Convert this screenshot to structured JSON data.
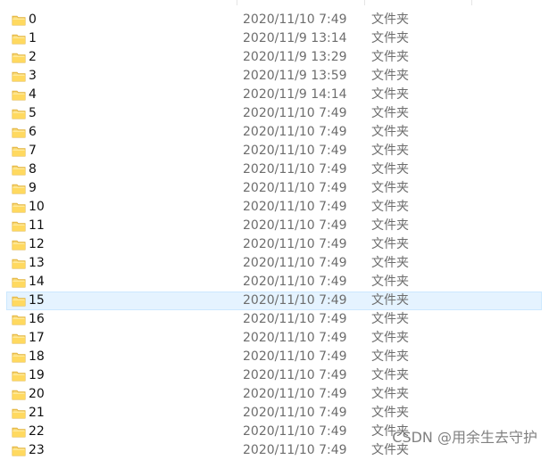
{
  "rows": [
    {
      "name": "0",
      "date": "2020/11/10 7:49",
      "type": "文件夹"
    },
    {
      "name": "1",
      "date": "2020/11/9 13:14",
      "type": "文件夹"
    },
    {
      "name": "2",
      "date": "2020/11/9 13:29",
      "type": "文件夹"
    },
    {
      "name": "3",
      "date": "2020/11/9 13:59",
      "type": "文件夹"
    },
    {
      "name": "4",
      "date": "2020/11/9 14:14",
      "type": "文件夹"
    },
    {
      "name": "5",
      "date": "2020/11/10 7:49",
      "type": "文件夹"
    },
    {
      "name": "6",
      "date": "2020/11/10 7:49",
      "type": "文件夹"
    },
    {
      "name": "7",
      "date": "2020/11/10 7:49",
      "type": "文件夹"
    },
    {
      "name": "8",
      "date": "2020/11/10 7:49",
      "type": "文件夹"
    },
    {
      "name": "9",
      "date": "2020/11/10 7:49",
      "type": "文件夹"
    },
    {
      "name": "10",
      "date": "2020/11/10 7:49",
      "type": "文件夹"
    },
    {
      "name": "11",
      "date": "2020/11/10 7:49",
      "type": "文件夹"
    },
    {
      "name": "12",
      "date": "2020/11/10 7:49",
      "type": "文件夹"
    },
    {
      "name": "13",
      "date": "2020/11/10 7:49",
      "type": "文件夹"
    },
    {
      "name": "14",
      "date": "2020/11/10 7:49",
      "type": "文件夹"
    },
    {
      "name": "15",
      "date": "2020/11/10 7:49",
      "type": "文件夹"
    },
    {
      "name": "16",
      "date": "2020/11/10 7:49",
      "type": "文件夹"
    },
    {
      "name": "17",
      "date": "2020/11/10 7:49",
      "type": "文件夹"
    },
    {
      "name": "18",
      "date": "2020/11/10 7:49",
      "type": "文件夹"
    },
    {
      "name": "19",
      "date": "2020/11/10 7:49",
      "type": "文件夹"
    },
    {
      "name": "20",
      "date": "2020/11/10 7:49",
      "type": "文件夹"
    },
    {
      "name": "21",
      "date": "2020/11/10 7:49",
      "type": "文件夹"
    },
    {
      "name": "22",
      "date": "2020/11/10 7:49",
      "type": "文件夹"
    },
    {
      "name": "23",
      "date": "2020/11/10 7:49",
      "type": "文件夹"
    }
  ],
  "selected_row": "15",
  "icons": {
    "folder": "folder-icon"
  },
  "colors": {
    "selection_background": "#e5f3ff",
    "selection_border": "#cce8ff",
    "folder_yellow": "#f8d775",
    "folder_dark": "#e2b33b",
    "secondary_text": "#6d6d6d"
  },
  "watermark": "CSDN @用余生去守护"
}
